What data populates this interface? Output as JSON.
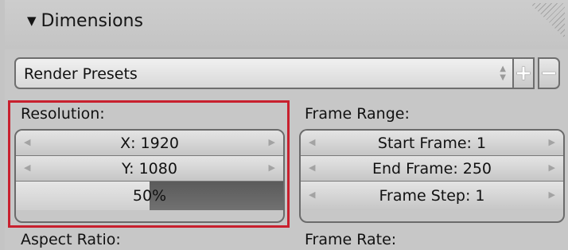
{
  "panel": {
    "title": "Dimensions"
  },
  "preset": {
    "label": "Render Presets",
    "add_symbol": "+",
    "remove_symbol": "−"
  },
  "resolution": {
    "label": "Resolution:",
    "x": "X: 1920",
    "y": "Y: 1080",
    "percent": "50%",
    "percent_value": 0.5
  },
  "frame_range": {
    "label": "Frame Range:",
    "start": "Start Frame: 1",
    "end": "End Frame: 250",
    "step": "Frame Step: 1"
  },
  "aspect": {
    "label": "Aspect Ratio:"
  },
  "frame_rate": {
    "label": "Frame Rate:"
  },
  "colors": {
    "highlight": "#c8202e"
  }
}
